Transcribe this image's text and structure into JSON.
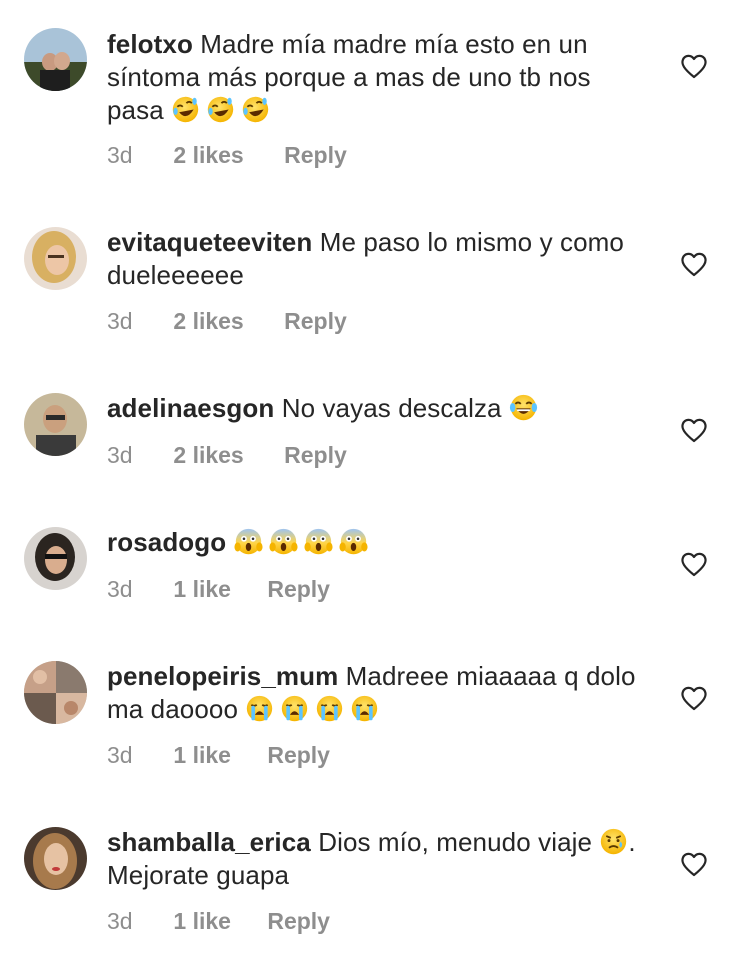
{
  "comments": [
    {
      "username": "felotxo",
      "text": "Madre mía madre mía esto en un síntoma más porque a mas de uno tb nos pasa",
      "emojis_after": [
        "rofl-emoji",
        "rofl-emoji",
        "rofl-emoji"
      ],
      "time": "3d",
      "likes": "2 likes",
      "reply": "Reply"
    },
    {
      "username": "evitaqueteeviten",
      "text": "Me paso lo mismo y como dueleeeeee",
      "emojis_after": [],
      "time": "3d",
      "likes": "2 likes",
      "reply": "Reply"
    },
    {
      "username": "adelinaesgon",
      "text": "No vayas descalza",
      "emojis_after": [
        "tears-of-joy-emoji"
      ],
      "time": "3d",
      "likes": "2 likes",
      "reply": "Reply"
    },
    {
      "username": "rosadogo",
      "text": "",
      "emojis_after": [
        "scream-emoji",
        "scream-emoji",
        "scream-emoji",
        "scream-emoji"
      ],
      "time": "3d",
      "likes": "1 like",
      "reply": "Reply"
    },
    {
      "username": "penelopeiris_mum",
      "text": "Madreee miaaaaa q dolo ma daoooo",
      "emojis_after": [
        "loudly-crying-emoji",
        "loudly-crying-emoji",
        "loudly-crying-emoji",
        "loudly-crying-emoji"
      ],
      "time": "3d",
      "likes": "1 like",
      "reply": "Reply"
    },
    {
      "username": "shamballa_erica",
      "text_before_emoji": "Dios mío, menudo viaje",
      "emoji_mid": "sad-relieved-emoji",
      "text_after_emoji": ". Mejorate guapa",
      "time": "3d",
      "likes": "1 like",
      "reply": "Reply"
    }
  ],
  "icons": {
    "like": "heart-outline-icon"
  },
  "colors": {
    "text": "#262626",
    "meta": "#8e8e8e",
    "background": "#ffffff"
  }
}
